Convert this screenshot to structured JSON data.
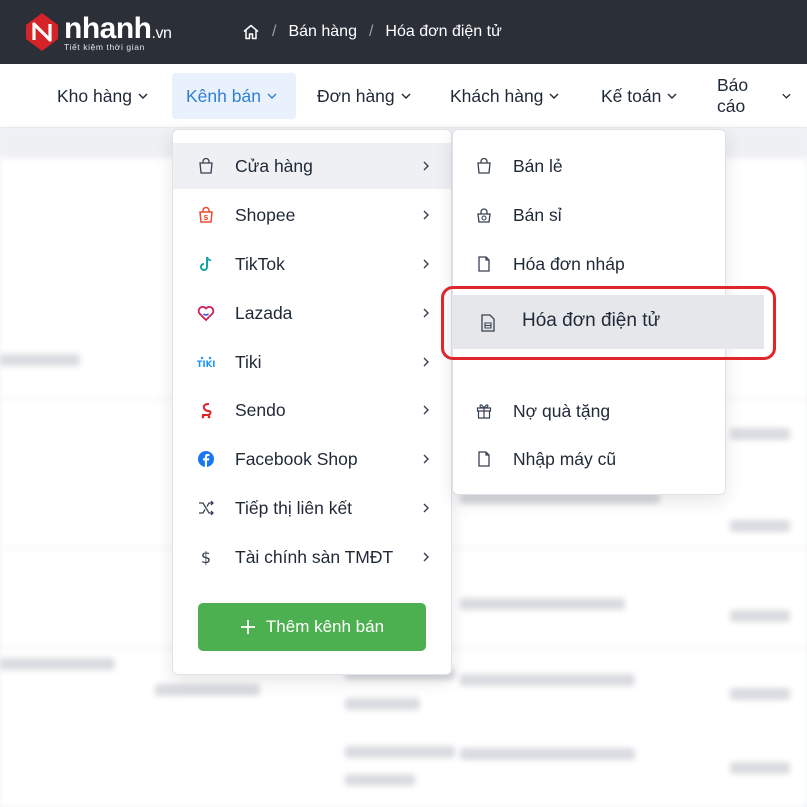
{
  "brand": {
    "name": "nhanh",
    "suffix": ".vn",
    "tagline": "Tiết kiệm thời gian"
  },
  "breadcrumb": {
    "section": "Bán hàng",
    "page": "Hóa đơn điện tử"
  },
  "nav": [
    {
      "label": "Kho hàng"
    },
    {
      "label": "Kênh bán"
    },
    {
      "label": "Đơn hàng"
    },
    {
      "label": "Khách hàng"
    },
    {
      "label": "Kế toán"
    },
    {
      "label": "Báo cáo"
    }
  ],
  "channels_menu": {
    "items": [
      {
        "label": "Cửa hàng",
        "icon": "shopping-bag-icon"
      },
      {
        "label": "Shopee",
        "icon": "shopee-icon"
      },
      {
        "label": "TikTok",
        "icon": "tiktok-icon"
      },
      {
        "label": "Lazada",
        "icon": "lazada-icon"
      },
      {
        "label": "Tiki",
        "icon": "tiki-icon"
      },
      {
        "label": "Sendo",
        "icon": "sendo-icon"
      },
      {
        "label": "Facebook Shop",
        "icon": "facebook-icon"
      },
      {
        "label": "Tiếp thị liên kết",
        "icon": "shuffle-icon"
      },
      {
        "label": "Tài chính sàn TMĐT",
        "icon": "dollar-icon"
      }
    ],
    "add_button": "Thêm kênh bán"
  },
  "store_submenu": {
    "items": [
      {
        "label": "Bán lẻ",
        "icon": "shopping-bag-icon"
      },
      {
        "label": "Bán sỉ",
        "icon": "wholesale-icon"
      },
      {
        "label": "Hóa đơn nháp",
        "icon": "file-icon"
      },
      {
        "label": "Hóa đơn điện tử",
        "icon": "invoice-icon"
      },
      {
        "label": "Nợ quà tặng",
        "icon": "gift-icon"
      },
      {
        "label": "Nhập máy cũ",
        "icon": "file-icon"
      }
    ]
  },
  "colors": {
    "topbar": "#2b2f38",
    "accent": "#2f7fd8",
    "add_button": "#4caf50",
    "callout": "#e0262a"
  }
}
